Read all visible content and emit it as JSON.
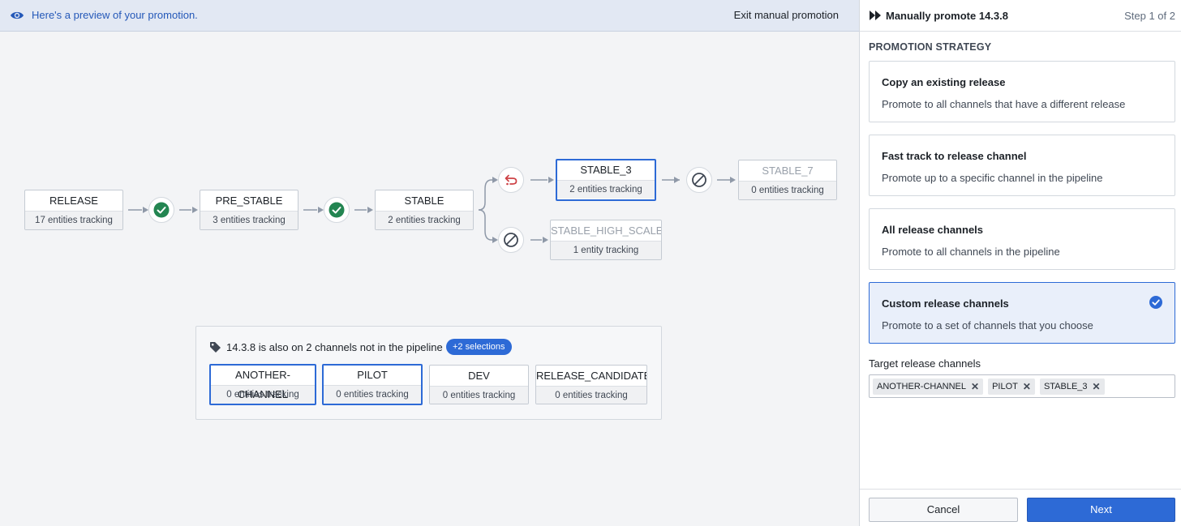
{
  "banner": {
    "message": "Here's a preview of your promotion.",
    "exit_label": "Exit manual promotion"
  },
  "pipeline": {
    "release": {
      "name": "RELEASE",
      "tracking": "17 entities tracking"
    },
    "pre_stable": {
      "name": "PRE_STABLE",
      "tracking": "3 entities tracking"
    },
    "stable": {
      "name": "STABLE",
      "tracking": "2 entities tracking"
    },
    "stable_3": {
      "name": "STABLE_3",
      "tracking": "2 entities tracking"
    },
    "stable_7": {
      "name": "STABLE_7",
      "tracking": "0 entities tracking"
    },
    "stable_high_scale": {
      "name": "STABLE_HIGH_SCALE",
      "tracking": "1 entity tracking"
    }
  },
  "extra_channels": {
    "info": "14.3.8 is also on 2 channels not in the pipeline",
    "badge": "+2 selections",
    "items": [
      {
        "name": "ANOTHER-CHANNEL",
        "tracking": "0 entities tracking"
      },
      {
        "name": "PILOT",
        "tracking": "0 entities tracking"
      },
      {
        "name": "DEV",
        "tracking": "0 entities tracking"
      },
      {
        "name": "RELEASE_CANDIDATE",
        "tracking": "0 entities tracking"
      }
    ]
  },
  "panel": {
    "title": "Manually promote 14.3.8",
    "step": "Step 1 of 2",
    "section_title": "PROMOTION STRATEGY",
    "options": [
      {
        "title": "Copy an existing release",
        "desc": "Promote to all channels that have a different release"
      },
      {
        "title": "Fast track to release channel",
        "desc": "Promote up to a specific channel in the pipeline"
      },
      {
        "title": "All release channels",
        "desc": "Promote to all channels in the pipeline"
      },
      {
        "title": "Custom release channels",
        "desc": "Promote to a set of channels that you choose"
      }
    ],
    "target_label": "Target release channels",
    "targets": [
      "ANOTHER-CHANNEL",
      "PILOT",
      "STABLE_3"
    ],
    "cancel_label": "Cancel",
    "next_label": "Next"
  },
  "colors": {
    "accent": "#2d6ad6",
    "success": "#238551",
    "danger": "#cd4246"
  }
}
